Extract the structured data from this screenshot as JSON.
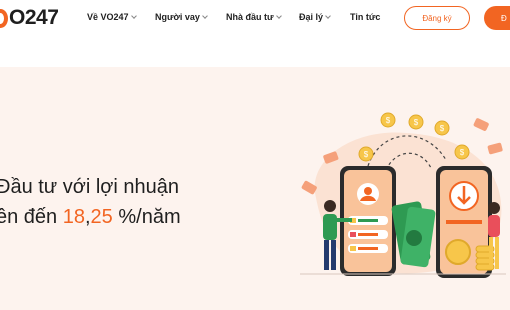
{
  "header": {
    "logo_text": "O247",
    "nav": [
      {
        "label": "Về VO247",
        "caret": true
      },
      {
        "label": "Người vay",
        "caret": true
      },
      {
        "label": "Nhà đầu tư",
        "caret": true
      },
      {
        "label": "Đại lý",
        "caret": true
      },
      {
        "label": "Tin tức",
        "caret": false
      }
    ],
    "register_label": "Đăng ký",
    "login_label": "Đ"
  },
  "hero": {
    "line1": "Đầu tư với lợi nhuận",
    "line2_prefix": "ên đến ",
    "rate_int": "18",
    "rate_sep": ",",
    "rate_dec": "25",
    "line2_suffix": " %/năm"
  },
  "colors": {
    "accent": "#f26522",
    "hero_bg": "#fdf3ee",
    "text": "#1f1f1f",
    "phone_bg": "#f9c39a",
    "coin": "#f7c64a",
    "money_green": "#2e9a52"
  }
}
